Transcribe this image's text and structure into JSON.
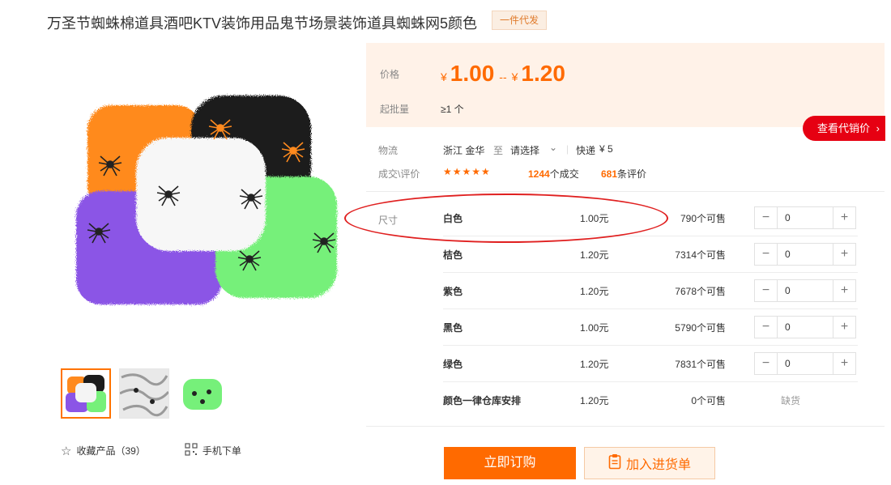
{
  "product": {
    "title": "万圣节蜘蛛棉道具酒吧KTV装饰用品鬼节场景装饰道具蜘蛛网5颜色",
    "badge": "一件代发"
  },
  "price": {
    "label": "价格",
    "currency": "¥",
    "low": "1.00",
    "sep": "--",
    "high": "1.20",
    "moq_label": "起批量",
    "moq_value": "≥1 个",
    "agent_button": "查看代销价"
  },
  "logistics": {
    "label": "物流",
    "from": "浙江 金华",
    "to_word": "至",
    "select": "请选择",
    "express": "快递",
    "fee": "¥ 5"
  },
  "deals": {
    "label": "成交\\评价",
    "stars": "★★★★★",
    "sold_count": "1244",
    "sold_suffix": "个成交",
    "review_count": "681",
    "review_suffix": "条评价"
  },
  "sku": {
    "label": "尺寸",
    "rows": [
      {
        "name": "白色",
        "price": "1.00元",
        "stock": "790个可售",
        "qty": "0"
      },
      {
        "name": "桔色",
        "price": "1.20元",
        "stock": "7314个可售",
        "qty": "0"
      },
      {
        "name": "紫色",
        "price": "1.20元",
        "stock": "7678个可售",
        "qty": "0"
      },
      {
        "name": "黑色",
        "price": "1.00元",
        "stock": "5790个可售",
        "qty": "0"
      },
      {
        "name": "绿色",
        "price": "1.20元",
        "stock": "7831个可售",
        "qty": "0"
      },
      {
        "name": "颜色一律仓库安排",
        "price": "1.20元",
        "stock": "0个可售",
        "status": "缺货"
      }
    ]
  },
  "actions": {
    "buy": "立即订购",
    "cart": "加入进货单"
  },
  "tools": {
    "favorite": "收藏产品（39）",
    "mobile": "手机下单"
  },
  "colors": {
    "accent": "#ff6a00",
    "red": "#e60012",
    "price_bg": "#fff2e8"
  }
}
